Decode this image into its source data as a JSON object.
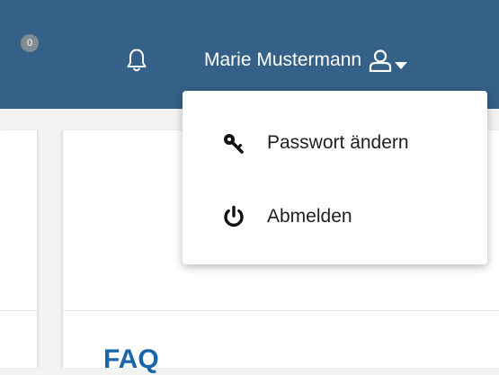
{
  "header": {
    "notifications": {
      "icon": "bell-icon",
      "count": "0"
    },
    "user": {
      "name": "Marie Mustermann",
      "icon": "user-icon",
      "menu_icon": "chevron-down-icon"
    }
  },
  "user_menu": {
    "items": [
      {
        "label": "Passwort ändern",
        "icon": "key-icon"
      },
      {
        "label": "Abmelden",
        "icon": "power-icon"
      }
    ]
  },
  "content": {
    "card_heading": "FAQ"
  },
  "colors": {
    "header_bg": "#356087",
    "badge_bg": "#828a92",
    "link": "#1a66a8"
  }
}
